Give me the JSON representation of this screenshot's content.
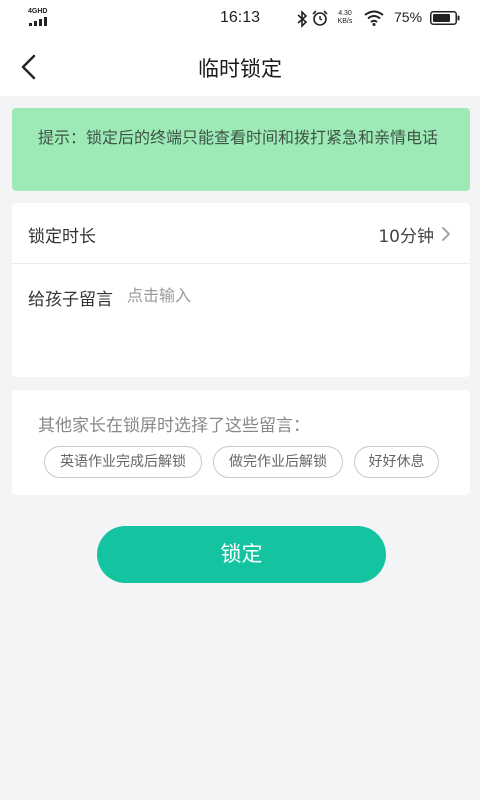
{
  "status_bar": {
    "network_label": "4GHD",
    "time": "16:13",
    "speed_value": "4.30",
    "speed_unit": "KB/s",
    "battery_percent": "75%",
    "icons": [
      "signal-icon",
      "bluetooth-icon",
      "alarm-icon",
      "wifi-icon",
      "battery-icon"
    ]
  },
  "nav": {
    "title": "临时锁定",
    "back_icon": "chevron-left-icon"
  },
  "tip": {
    "text": "提示：锁定后的终端只能查看时间和拨打紧急和亲情电话"
  },
  "settings": {
    "duration_label": "锁定时长",
    "duration_value": "10分钟",
    "message_label": "给孩子留言",
    "message_value": "",
    "message_placeholder": "点击输入"
  },
  "suggestions": {
    "title": "其他家长在锁屏时选择了这些留言：",
    "chips": [
      "英语作业完成后解锁",
      "做完作业后解锁",
      "好好休息"
    ]
  },
  "actions": {
    "lock_label": "锁定"
  },
  "colors": {
    "accent": "#14c3a0",
    "tip_background": "#9deab6",
    "page_background": "#f3f4f5"
  }
}
